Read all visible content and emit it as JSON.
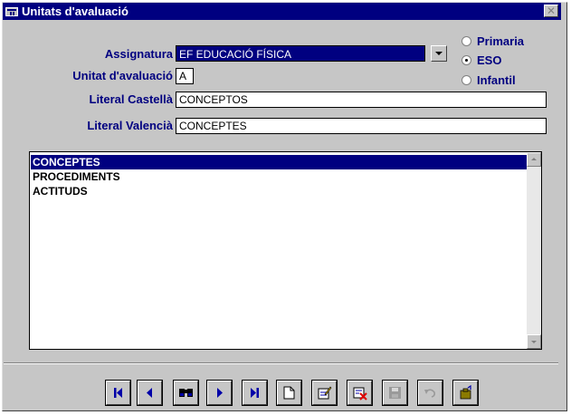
{
  "window": {
    "title": "Unitats d'avaluació",
    "close_glyph": "✕"
  },
  "form": {
    "assignatura_label": "Assignatura",
    "assignatura_value": "EF  EDUCACIÓ FÍSICA",
    "unitat_label": "Unitat d'avaluació",
    "unitat_value": "A",
    "castella_label": "Literal Castellà",
    "castella_value": "CONCEPTOS",
    "valencia_label": "Literal Valencià",
    "valencia_value": "CONCEPTES"
  },
  "level": {
    "options": [
      {
        "label": "Primaria",
        "checked": false
      },
      {
        "label": "ESO",
        "checked": true
      },
      {
        "label": "Infantil",
        "checked": false
      }
    ]
  },
  "list": {
    "items": [
      "CONCEPTES",
      "PROCEDIMENTS",
      "ACTITUDS"
    ],
    "selected_index": 0
  },
  "toolbar": {
    "buttons": [
      {
        "name": "first-record-icon",
        "enabled": true
      },
      {
        "name": "previous-record-icon",
        "enabled": true
      },
      {
        "name": "search-binoculars-icon",
        "enabled": true
      },
      {
        "name": "next-record-icon",
        "enabled": true
      },
      {
        "name": "last-record-icon",
        "enabled": true
      },
      {
        "name": "new-document-icon",
        "enabled": true
      },
      {
        "name": "edit-icon",
        "enabled": true
      },
      {
        "name": "delete-icon",
        "enabled": true
      },
      {
        "name": "save-icon",
        "enabled": false
      },
      {
        "name": "undo-icon",
        "enabled": false
      },
      {
        "name": "exit-icon",
        "enabled": true
      }
    ]
  },
  "colors": {
    "accent": "#000080",
    "face": "#c6c6c6",
    "icon_blue": "#0000a8",
    "delete_red": "#e00000"
  }
}
